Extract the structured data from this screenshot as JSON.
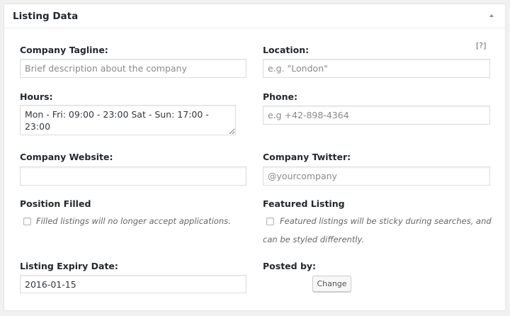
{
  "metabox": {
    "title": "Listing Data",
    "toggle_icon": "triangle-up-icon"
  },
  "fields": {
    "company_tagline": {
      "label": "Company Tagline:",
      "value": "",
      "placeholder": "Brief description about the company"
    },
    "location": {
      "label": "Location:",
      "help": "[?]",
      "value": "",
      "placeholder": "e.g. \"London\""
    },
    "hours": {
      "label": "Hours:",
      "value": "Mon - Fri: 09:00 - 23:00 Sat - Sun: 17:00 - 23:00",
      "placeholder": ""
    },
    "phone": {
      "label": "Phone:",
      "value": "",
      "placeholder": "e.g +42-898-4364"
    },
    "company_website": {
      "label": "Company Website:",
      "value": "",
      "placeholder": ""
    },
    "company_twitter": {
      "label": "Company Twitter:",
      "value": "",
      "placeholder": "@yourcompany"
    },
    "position_filled": {
      "label": "Position Filled",
      "checked": false,
      "description": "Filled listings will no longer accept applications."
    },
    "featured_listing": {
      "label": "Featured Listing",
      "checked": false,
      "description_line1": "Featured listings will be sticky during searches, and",
      "description_line2": "can be styled differently."
    },
    "listing_expiry": {
      "label": "Listing Expiry Date:",
      "value": "2016-01-15",
      "placeholder": ""
    },
    "posted_by": {
      "label": "Posted by:",
      "button_label": "Change"
    }
  }
}
